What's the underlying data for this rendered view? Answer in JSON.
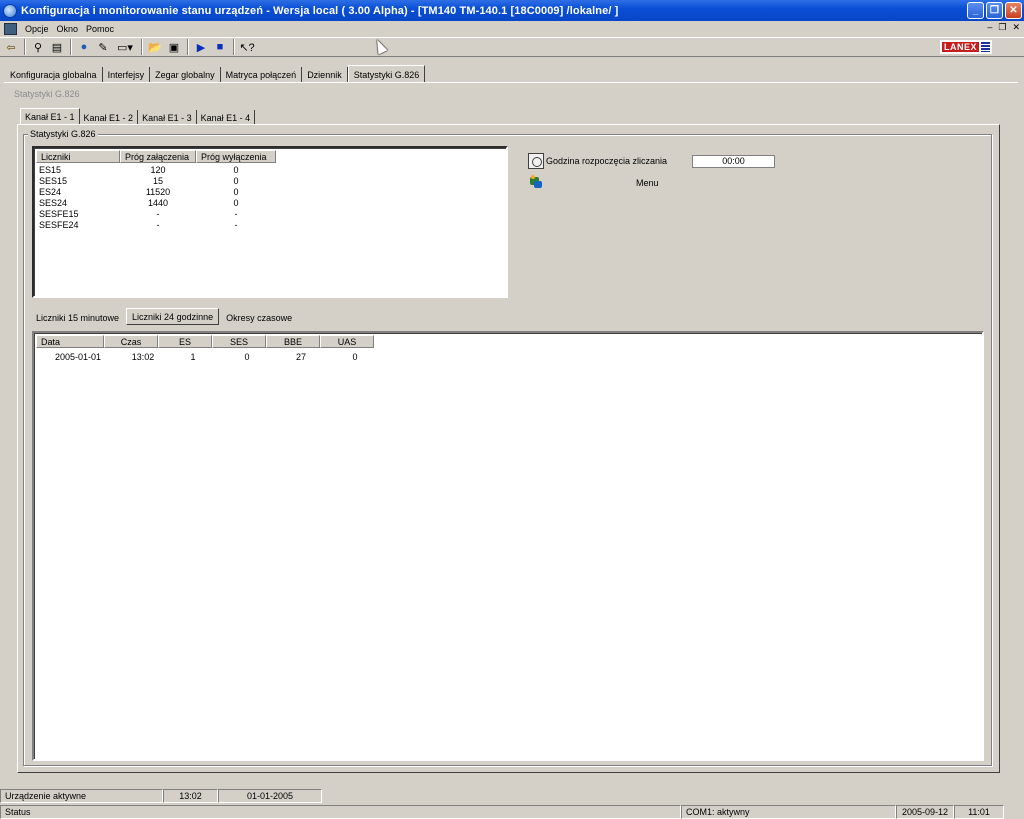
{
  "window": {
    "title": "Konfiguracja i monitorowanie stanu urządzeń  - Wersja local  ( 3.00 Alpha) - [TM140 TM-140.1 [18C0009] /lokalne/ ]"
  },
  "menu": [
    "Opcje",
    "Okno",
    "Pomoc"
  ],
  "toolbar": {
    "logo_text": "LANEX"
  },
  "top_tabs": [
    "Konfiguracja globalna",
    "Interfejsy",
    "Zegar globalny",
    "Matryca połączeń",
    "Dziennik",
    "Statystyki G.826"
  ],
  "active_top_tab": 5,
  "ghost_label": "Statystyki G.826",
  "channel_tabs": [
    "Kanał E1  - 1",
    "Kanał E1  - 2",
    "Kanał E1  - 3",
    "Kanał E1  - 4"
  ],
  "group_title": "Statystyki G.826",
  "thresholds": {
    "headers": [
      "Liczniki",
      "Próg załączenia",
      "Próg wyłączenia"
    ],
    "rows": [
      [
        "ES15",
        "120",
        "0"
      ],
      [
        "SES15",
        "15",
        "0"
      ],
      [
        "ES24",
        "11520",
        "0"
      ],
      [
        "SES24",
        "1440",
        "0"
      ],
      [
        "SESFE15",
        "-",
        "-"
      ],
      [
        "SESFE24",
        "-",
        "-"
      ]
    ]
  },
  "start_time": {
    "label": "Godzina rozpoczęcia zliczania",
    "value": "00:00"
  },
  "menu_button_label": "Menu",
  "lower_tabs": [
    "Liczniki 15 minutowe",
    "Liczniki 24 godzinne",
    "Okresy czasowe"
  ],
  "active_lower_tab": 1,
  "counters": {
    "headers": [
      "Data",
      "Czas",
      "ES",
      "SES",
      "BBE",
      "UAS"
    ],
    "rows": [
      [
        "2005-01-01",
        "13:02",
        "1",
        "0",
        "27",
        "0"
      ]
    ]
  },
  "status1": {
    "device": "Urządzenie aktywne",
    "time": "13:02",
    "date": "01-01-2005"
  },
  "status2": {
    "label": "Status",
    "port": "COM1: aktywny",
    "date": "2005-09-12",
    "time": "11:01"
  },
  "colors": {
    "titlebar": "#0a4fd6",
    "face": "#d4d0c8",
    "logo_red": "#c41e1e",
    "logo_blue": "#1c2f9a"
  }
}
